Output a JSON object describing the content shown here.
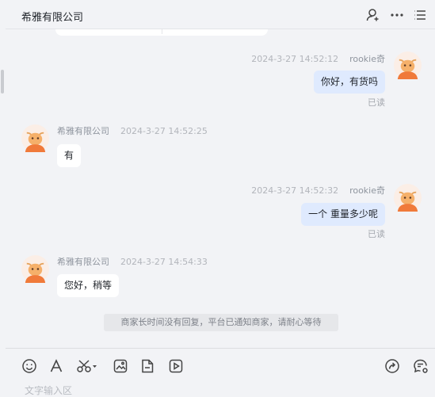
{
  "header": {
    "title": "希雅有限公司",
    "icons": [
      "person-icon",
      "more-dots-icon",
      "list-menu-icon"
    ]
  },
  "messages": [
    {
      "from": "me",
      "sender": "rookie奇",
      "time": "2024-3-27 14:52:12",
      "text": "你好，有货吗",
      "status": "已读"
    },
    {
      "from": "them",
      "sender": "希雅有限公司",
      "time": "2024-3-27 14:52:25",
      "text": "有"
    },
    {
      "from": "me",
      "sender": "rookie奇",
      "time": "2024-3-27 14:52:32",
      "text": "一个 重量多少呢",
      "status": "已读"
    },
    {
      "from": "them",
      "sender": "希雅有限公司",
      "time": "2024-3-27 14:54:33",
      "text": "您好，稍等"
    }
  ],
  "system_notice": "商家长时间没有回复，平台已通知商家，请耐心等待",
  "toolbar": {
    "icons": [
      "emoji-icon",
      "font-icon",
      "scissors-icon",
      "image-icon",
      "file-icon",
      "video-icon",
      "share-icon",
      "chat-settings-icon"
    ]
  },
  "input": {
    "placeholder": "文字输入区"
  },
  "colors": {
    "background": "#f2f3f6",
    "my_bubble": "#dfeafe",
    "their_bubble": "#ffffff",
    "avatar_accent": "#f07a3a"
  }
}
